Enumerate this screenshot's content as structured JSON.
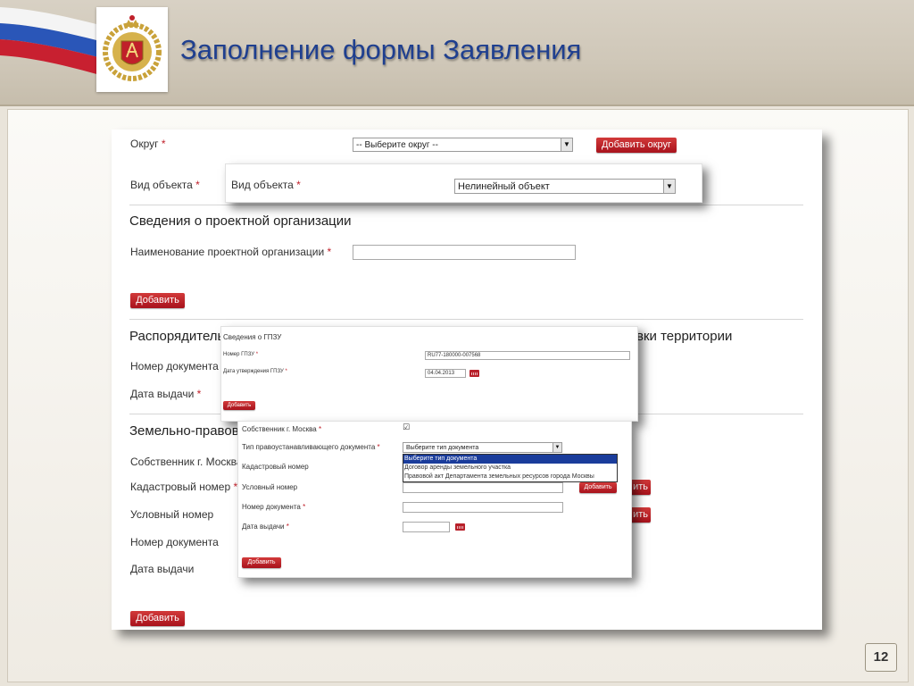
{
  "slide": {
    "title": "Заполнение формы Заявления",
    "page_number": "12"
  },
  "base_form": {
    "okrug_label": "Округ",
    "okrug_select": "-- Выберите округ --",
    "add_okrug_button": "Добавить округ",
    "object_type_label": "Вид объекта",
    "project_org_section": "Сведения о проектной организации",
    "project_org_name_label": "Наименование проектной организации",
    "add_button_1": "Добавить",
    "distributive_section": "Распорядитель",
    "territory_section_tail": "вки территории",
    "doc_number_label_1": "Номер документа",
    "issue_date_label_1": "Дата выдачи",
    "land_section": "Земельно-правов",
    "owner_label": "Собственник г. Москва",
    "cadastral_label": "Кадастровый номер",
    "conditional_label": "Условный номер",
    "doc_number_label_2": "Номер документа",
    "issue_date_label_2": "Дата выдачи",
    "add_button_bottom": "Добавить",
    "peek_button_text_1": "ить",
    "peek_button_text_2": "ить"
  },
  "object_type_popup": {
    "label": "Вид объекта",
    "value": "Нелинейный объект"
  },
  "gpzu_popup": {
    "title": "Сведения о ГПЗУ",
    "number_label": "Номер ГПЗУ",
    "number_value": "RU77-180000-007568",
    "date_label": "Дата утверждения ГПЗУ",
    "date_value": "04.04.2013",
    "add_button": "Добавить"
  },
  "land_popup": {
    "owner_label": "Собственник г. Москва",
    "owner_checked_mark": "☑",
    "doc_type_label": "Тип правоустанавливающего документа",
    "doc_type_select": "Выберите тип документа",
    "dropdown_options": [
      "Выберите тип документа",
      "Договор аренды земельного участка",
      "Правовой акт Департамента земельных ресурсов города Москвы"
    ],
    "cadastral_label": "Кадастровый номер",
    "conditional_label": "Условный номер",
    "add_small_button": "Добавить",
    "doc_number_label": "Номер документа",
    "issue_date_label": "Дата выдачи",
    "add_button": "Добавить"
  },
  "colors": {
    "title_blue": "#1f3f8f",
    "button_red": "#b8202a",
    "required_red": "#c0202a",
    "dropdown_highlight": "#1a3c9b"
  }
}
